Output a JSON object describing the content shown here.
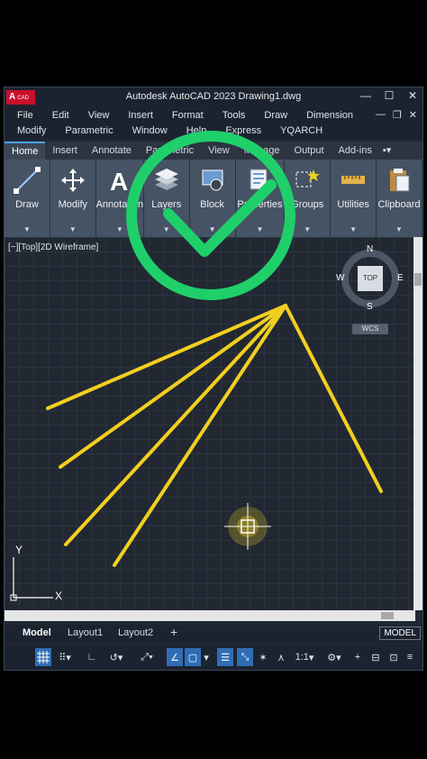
{
  "window": {
    "logo_text": "A",
    "logo_sub": "CAD",
    "title": "Autodesk AutoCAD 2023   Drawing1.dwg",
    "controls": [
      "—",
      "☐",
      "✕"
    ]
  },
  "menubar": {
    "row1": [
      "File",
      "Edit",
      "View",
      "Insert",
      "Format",
      "Tools",
      "Draw",
      "Dimension"
    ],
    "row2": [
      "Modify",
      "Parametric",
      "Window",
      "Help",
      "Express",
      "YQARCH"
    ],
    "mdi_controls": [
      "—",
      "❐",
      "✕"
    ]
  },
  "ribbon_tabs": [
    "Home",
    "Insert",
    "Annotate",
    "Parametric",
    "View",
    "Manage",
    "Output",
    "Add-ins"
  ],
  "ribbon_panels": [
    {
      "label": "Draw",
      "icon": "line-draw-icon"
    },
    {
      "label": "Modify",
      "icon": "move-arrows-icon"
    },
    {
      "label": "Annotation",
      "icon": "text-a-icon"
    },
    {
      "label": "Layers",
      "icon": "layers-stack-icon"
    },
    {
      "label": "Block",
      "icon": "block-icon"
    },
    {
      "label": "Properties",
      "icon": "properties-icon"
    },
    {
      "label": "Groups",
      "icon": "groups-icon"
    },
    {
      "label": "Utilities",
      "icon": "ruler-icon"
    },
    {
      "label": "Clipboard",
      "icon": "clipboard-icon"
    }
  ],
  "viewport": {
    "label": "[−][Top][2D Wireframe]",
    "viewcube": {
      "top": "TOP",
      "n": "N",
      "s": "S",
      "e": "E",
      "w": "W",
      "wcs": "WCS"
    },
    "ucs": {
      "x": "X",
      "y": "Y"
    }
  },
  "overlay": {
    "checkmark_color": "#1fd06a",
    "line_color": "#f2cf1f"
  },
  "layout_tabs": [
    "Model",
    "Layout1",
    "Layout2",
    "+"
  ],
  "model_badge": "MODEL",
  "statusbar": {
    "scale": "1:1",
    "items": [
      "grid-icon",
      "snap-icon",
      "ortho-icon",
      "polar-icon",
      "osnap-icon",
      "otrack-icon",
      "lineweight-icon",
      "transparency-icon",
      "selection-cycling-icon",
      "annotation-scale-icon",
      "workspace-gear-icon",
      "add-icon",
      "isolate-icon",
      "fullscreen-icon",
      "customize-icon"
    ]
  }
}
